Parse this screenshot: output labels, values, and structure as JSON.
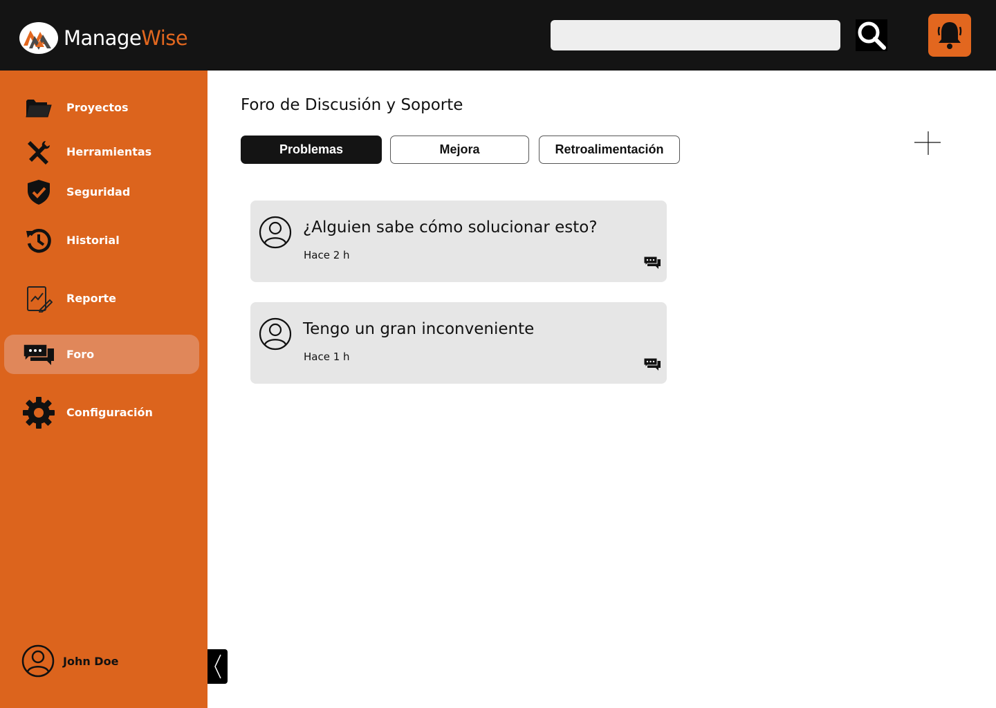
{
  "header": {
    "brand_part1": "Manage",
    "brand_part2": "Wise",
    "search_placeholder": "",
    "search_icon": "search-icon",
    "notification_icon": "bell-icon"
  },
  "sidebar": {
    "items": [
      {
        "label": "Proyectos",
        "icon": "folder-icon"
      },
      {
        "label": "Herramientas",
        "icon": "tools-icon"
      },
      {
        "label": "Seguridad",
        "icon": "shield-icon"
      },
      {
        "label": "Historial",
        "icon": "history-icon"
      },
      {
        "label": "Reporte",
        "icon": "report-icon"
      },
      {
        "label": "Foro",
        "icon": "chat-icon",
        "active": true
      },
      {
        "label": "Configuración",
        "icon": "gear-icon"
      }
    ],
    "user_name": "John Doe"
  },
  "main": {
    "title": "Foro de Discusión y Soporte",
    "tabs": [
      {
        "label": "Problemas",
        "active": true
      },
      {
        "label": "Mejora",
        "active": false
      },
      {
        "label": "Retroalimentación",
        "active": false
      }
    ],
    "posts": [
      {
        "title": "¿Alguien sabe cómo solucionar esto?",
        "time": "Hace 2 h"
      },
      {
        "title": "Tengo un gran inconveniente",
        "time": "Hace 1 h"
      }
    ]
  },
  "colors": {
    "accent": "#dc641d",
    "header_bg": "#141414",
    "active_nav": "#e0875a",
    "card_bg": "#e6e6e6"
  }
}
